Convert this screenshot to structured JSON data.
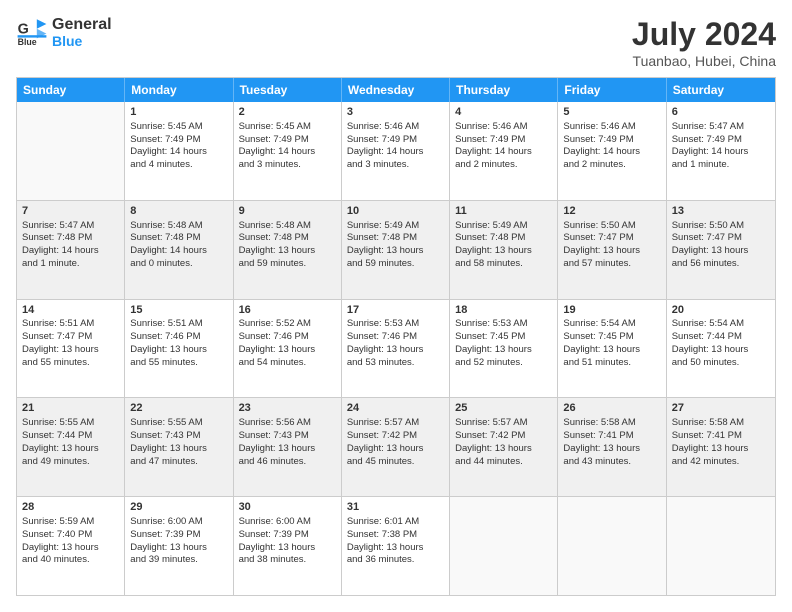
{
  "logo": {
    "line1": "General",
    "line2": "Blue"
  },
  "title": "July 2024",
  "subtitle": "Tuanbao, Hubei, China",
  "days": [
    "Sunday",
    "Monday",
    "Tuesday",
    "Wednesday",
    "Thursday",
    "Friday",
    "Saturday"
  ],
  "weeks": [
    [
      {
        "empty": true
      },
      {
        "num": "1",
        "lines": [
          "Sunrise: 5:45 AM",
          "Sunset: 7:49 PM",
          "Daylight: 14 hours",
          "and 4 minutes."
        ]
      },
      {
        "num": "2",
        "lines": [
          "Sunrise: 5:45 AM",
          "Sunset: 7:49 PM",
          "Daylight: 14 hours",
          "and 3 minutes."
        ]
      },
      {
        "num": "3",
        "lines": [
          "Sunrise: 5:46 AM",
          "Sunset: 7:49 PM",
          "Daylight: 14 hours",
          "and 3 minutes."
        ]
      },
      {
        "num": "4",
        "lines": [
          "Sunrise: 5:46 AM",
          "Sunset: 7:49 PM",
          "Daylight: 14 hours",
          "and 2 minutes."
        ]
      },
      {
        "num": "5",
        "lines": [
          "Sunrise: 5:46 AM",
          "Sunset: 7:49 PM",
          "Daylight: 14 hours",
          "and 2 minutes."
        ]
      },
      {
        "num": "6",
        "lines": [
          "Sunrise: 5:47 AM",
          "Sunset: 7:49 PM",
          "Daylight: 14 hours",
          "and 1 minute."
        ]
      }
    ],
    [
      {
        "num": "7",
        "lines": [
          "Sunrise: 5:47 AM",
          "Sunset: 7:48 PM",
          "Daylight: 14 hours",
          "and 1 minute."
        ]
      },
      {
        "num": "8",
        "lines": [
          "Sunrise: 5:48 AM",
          "Sunset: 7:48 PM",
          "Daylight: 14 hours",
          "and 0 minutes."
        ]
      },
      {
        "num": "9",
        "lines": [
          "Sunrise: 5:48 AM",
          "Sunset: 7:48 PM",
          "Daylight: 13 hours",
          "and 59 minutes."
        ]
      },
      {
        "num": "10",
        "lines": [
          "Sunrise: 5:49 AM",
          "Sunset: 7:48 PM",
          "Daylight: 13 hours",
          "and 59 minutes."
        ]
      },
      {
        "num": "11",
        "lines": [
          "Sunrise: 5:49 AM",
          "Sunset: 7:48 PM",
          "Daylight: 13 hours",
          "and 58 minutes."
        ]
      },
      {
        "num": "12",
        "lines": [
          "Sunrise: 5:50 AM",
          "Sunset: 7:47 PM",
          "Daylight: 13 hours",
          "and 57 minutes."
        ]
      },
      {
        "num": "13",
        "lines": [
          "Sunrise: 5:50 AM",
          "Sunset: 7:47 PM",
          "Daylight: 13 hours",
          "and 56 minutes."
        ]
      }
    ],
    [
      {
        "num": "14",
        "lines": [
          "Sunrise: 5:51 AM",
          "Sunset: 7:47 PM",
          "Daylight: 13 hours",
          "and 55 minutes."
        ]
      },
      {
        "num": "15",
        "lines": [
          "Sunrise: 5:51 AM",
          "Sunset: 7:46 PM",
          "Daylight: 13 hours",
          "and 55 minutes."
        ]
      },
      {
        "num": "16",
        "lines": [
          "Sunrise: 5:52 AM",
          "Sunset: 7:46 PM",
          "Daylight: 13 hours",
          "and 54 minutes."
        ]
      },
      {
        "num": "17",
        "lines": [
          "Sunrise: 5:53 AM",
          "Sunset: 7:46 PM",
          "Daylight: 13 hours",
          "and 53 minutes."
        ]
      },
      {
        "num": "18",
        "lines": [
          "Sunrise: 5:53 AM",
          "Sunset: 7:45 PM",
          "Daylight: 13 hours",
          "and 52 minutes."
        ]
      },
      {
        "num": "19",
        "lines": [
          "Sunrise: 5:54 AM",
          "Sunset: 7:45 PM",
          "Daylight: 13 hours",
          "and 51 minutes."
        ]
      },
      {
        "num": "20",
        "lines": [
          "Sunrise: 5:54 AM",
          "Sunset: 7:44 PM",
          "Daylight: 13 hours",
          "and 50 minutes."
        ]
      }
    ],
    [
      {
        "num": "21",
        "lines": [
          "Sunrise: 5:55 AM",
          "Sunset: 7:44 PM",
          "Daylight: 13 hours",
          "and 49 minutes."
        ]
      },
      {
        "num": "22",
        "lines": [
          "Sunrise: 5:55 AM",
          "Sunset: 7:43 PM",
          "Daylight: 13 hours",
          "and 47 minutes."
        ]
      },
      {
        "num": "23",
        "lines": [
          "Sunrise: 5:56 AM",
          "Sunset: 7:43 PM",
          "Daylight: 13 hours",
          "and 46 minutes."
        ]
      },
      {
        "num": "24",
        "lines": [
          "Sunrise: 5:57 AM",
          "Sunset: 7:42 PM",
          "Daylight: 13 hours",
          "and 45 minutes."
        ]
      },
      {
        "num": "25",
        "lines": [
          "Sunrise: 5:57 AM",
          "Sunset: 7:42 PM",
          "Daylight: 13 hours",
          "and 44 minutes."
        ]
      },
      {
        "num": "26",
        "lines": [
          "Sunrise: 5:58 AM",
          "Sunset: 7:41 PM",
          "Daylight: 13 hours",
          "and 43 minutes."
        ]
      },
      {
        "num": "27",
        "lines": [
          "Sunrise: 5:58 AM",
          "Sunset: 7:41 PM",
          "Daylight: 13 hours",
          "and 42 minutes."
        ]
      }
    ],
    [
      {
        "num": "28",
        "lines": [
          "Sunrise: 5:59 AM",
          "Sunset: 7:40 PM",
          "Daylight: 13 hours",
          "and 40 minutes."
        ]
      },
      {
        "num": "29",
        "lines": [
          "Sunrise: 6:00 AM",
          "Sunset: 7:39 PM",
          "Daylight: 13 hours",
          "and 39 minutes."
        ]
      },
      {
        "num": "30",
        "lines": [
          "Sunrise: 6:00 AM",
          "Sunset: 7:39 PM",
          "Daylight: 13 hours",
          "and 38 minutes."
        ]
      },
      {
        "num": "31",
        "lines": [
          "Sunrise: 6:01 AM",
          "Sunset: 7:38 PM",
          "Daylight: 13 hours",
          "and 36 minutes."
        ]
      },
      {
        "empty": true
      },
      {
        "empty": true
      },
      {
        "empty": true
      }
    ]
  ]
}
